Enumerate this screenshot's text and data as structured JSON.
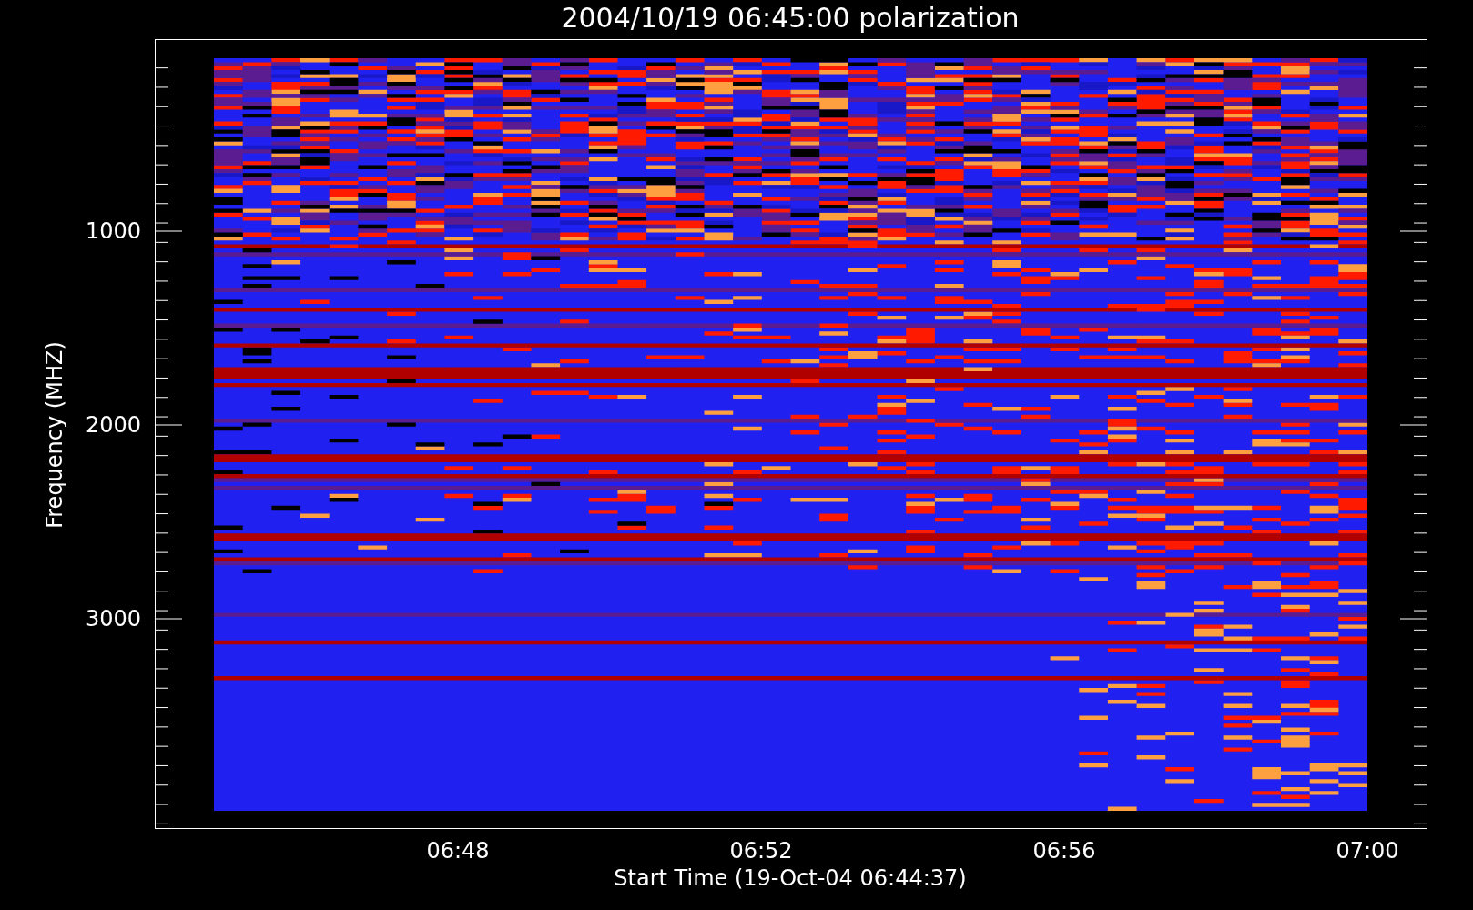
{
  "title": "2004/10/19 06:45:00 polarization",
  "y_axis": {
    "label": "Frequency (MHZ)",
    "ticks": [
      "1000",
      "2000",
      "3000"
    ]
  },
  "x_axis": {
    "label": "Start Time (19-Oct-04 06:44:37)",
    "ticks": [
      "06:48",
      "06:52",
      "06:56",
      "07:00"
    ]
  }
}
